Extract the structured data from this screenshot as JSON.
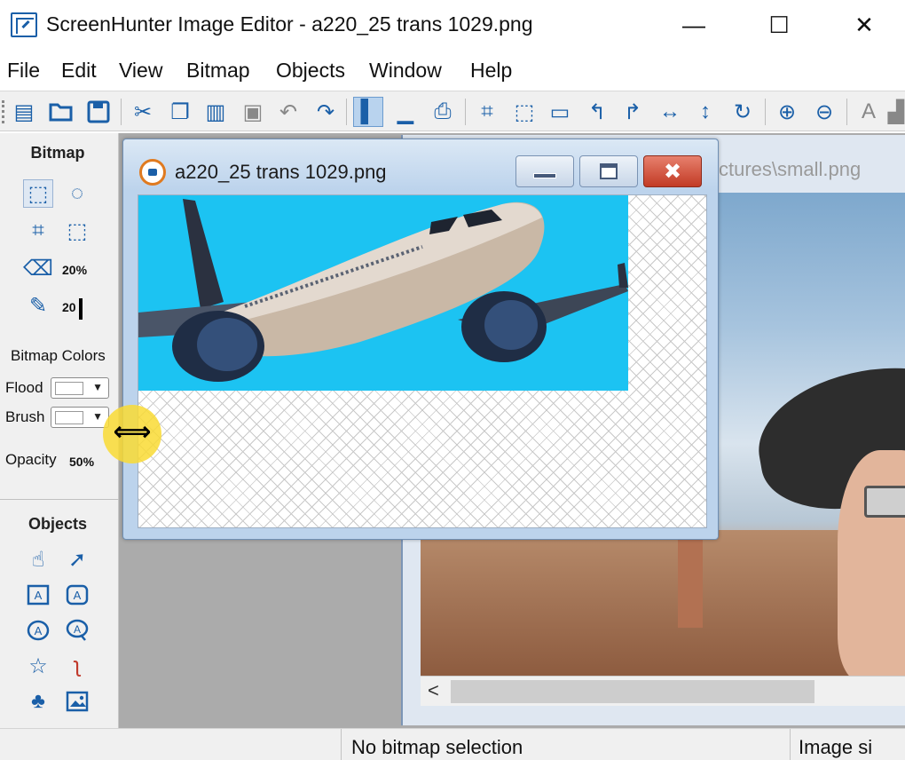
{
  "window": {
    "title": "ScreenHunter Image Editor - a220_25 trans 1029.png",
    "min_glyph": "—",
    "max_glyph": "☐",
    "close_glyph": "✕"
  },
  "menu": [
    "File",
    "Edit",
    "View",
    "Bitmap",
    "Objects",
    "Window",
    "Help"
  ],
  "toolbar": {
    "icons": [
      "capture-icon",
      "open-icon",
      "save-icon",
      "cut-icon",
      "copy-icon",
      "paste-icon",
      "select-all-icon",
      "undo-icon",
      "redo-icon",
      "vertical-line-icon",
      "horizontal-line-icon",
      "print-icon",
      "crop-icon",
      "crop-selection-icon",
      "frame-icon",
      "rotate-left-icon",
      "rotate-right-icon",
      "flip-horizontal-icon",
      "flip-vertical-icon",
      "rotate-icon",
      "zoom-in-icon",
      "zoom-out-icon",
      "text-icon"
    ]
  },
  "bitmap_panel": {
    "title": "Bitmap",
    "eraser_size": "20%",
    "brush_size": "20",
    "colors_title": "Bitmap Colors",
    "flood_label": "Flood",
    "brush_label": "Brush",
    "opacity_label": "Opacity",
    "opacity_value": "50%"
  },
  "objects_panel": {
    "title": "Objects"
  },
  "background_doc": {
    "title": "ctures\\small.png",
    "scroll_left_glyph": "<"
  },
  "foreground_doc": {
    "title": "a220_25 trans 1029.png"
  },
  "status": {
    "selection": "No bitmap selection",
    "image_size": "Image si"
  }
}
